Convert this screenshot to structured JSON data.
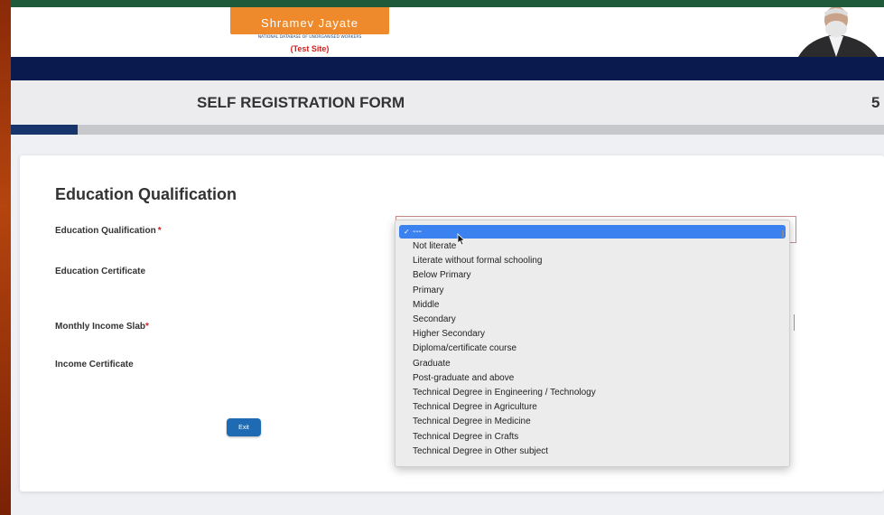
{
  "header": {
    "logo_tagline": "Shramev Jayate",
    "logo_subtitle": "NATIONAL DATABASE OF UNORGANISED WORKERS",
    "logo_test": "(Test Site)"
  },
  "form": {
    "title": "SELF REGISTRATION FORM",
    "step_number": "5",
    "progress": 0.077,
    "section_title": "Education Qualification",
    "fields": {
      "education_qualification": "Education Qualification",
      "education_certificate": "Education Certificate",
      "monthly_income_slab": "Monthly Income Slab",
      "income_certificate": "Income Certificate"
    },
    "required_mark": "*",
    "exit_label": "Exit"
  },
  "dropdown": {
    "check_glyph": "✓",
    "selected": "---",
    "options": [
      "Not literate",
      "Literate without formal schooling",
      "Below Primary",
      "Primary",
      "Middle",
      "Secondary",
      "Higher Secondary",
      "Diploma/certificate course",
      "Graduate",
      "Post-graduate and above",
      "Technical Degree in Engineering / Technology",
      "Technical Degree in Agriculture",
      "Technical Degree in Medicine",
      "Technical Degree in Crafts",
      "Technical Degree in Other subject"
    ]
  },
  "colors": {
    "navbar": "#0b1a4e",
    "progress_fill": "#17356b",
    "logo_orange": "#ef8a2c",
    "selected_option": "#3b82f0",
    "exit_button": "#1e6bb3"
  }
}
